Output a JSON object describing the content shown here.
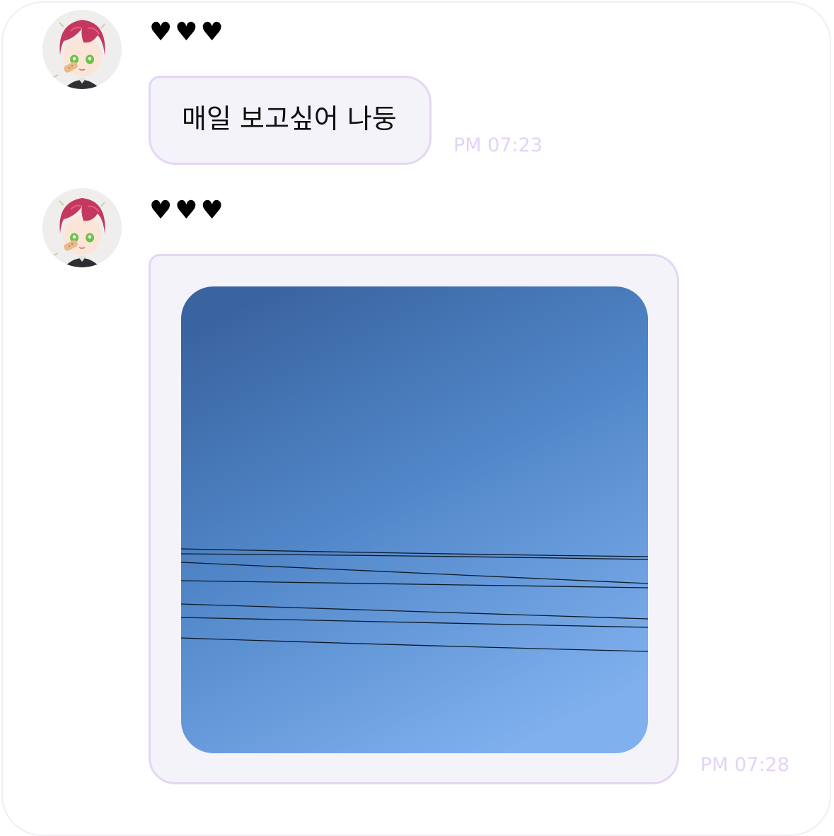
{
  "messages": [
    {
      "sender": "♥♥♥",
      "text": "매일 보고싶어 나둥",
      "time": "PM 07:23"
    },
    {
      "sender": "♥♥♥",
      "image": "photo-of-blue-sky-with-power-lines",
      "time": "PM 07:28"
    }
  ],
  "colors": {
    "bubble_bg": "#f4f3f9",
    "bubble_border": "#e4d6f5",
    "timestamp": "#e3d3f6",
    "avatar_hair": "#c4385f",
    "sky_top": "#3a64a0",
    "sky_bottom": "#7eaef0"
  }
}
